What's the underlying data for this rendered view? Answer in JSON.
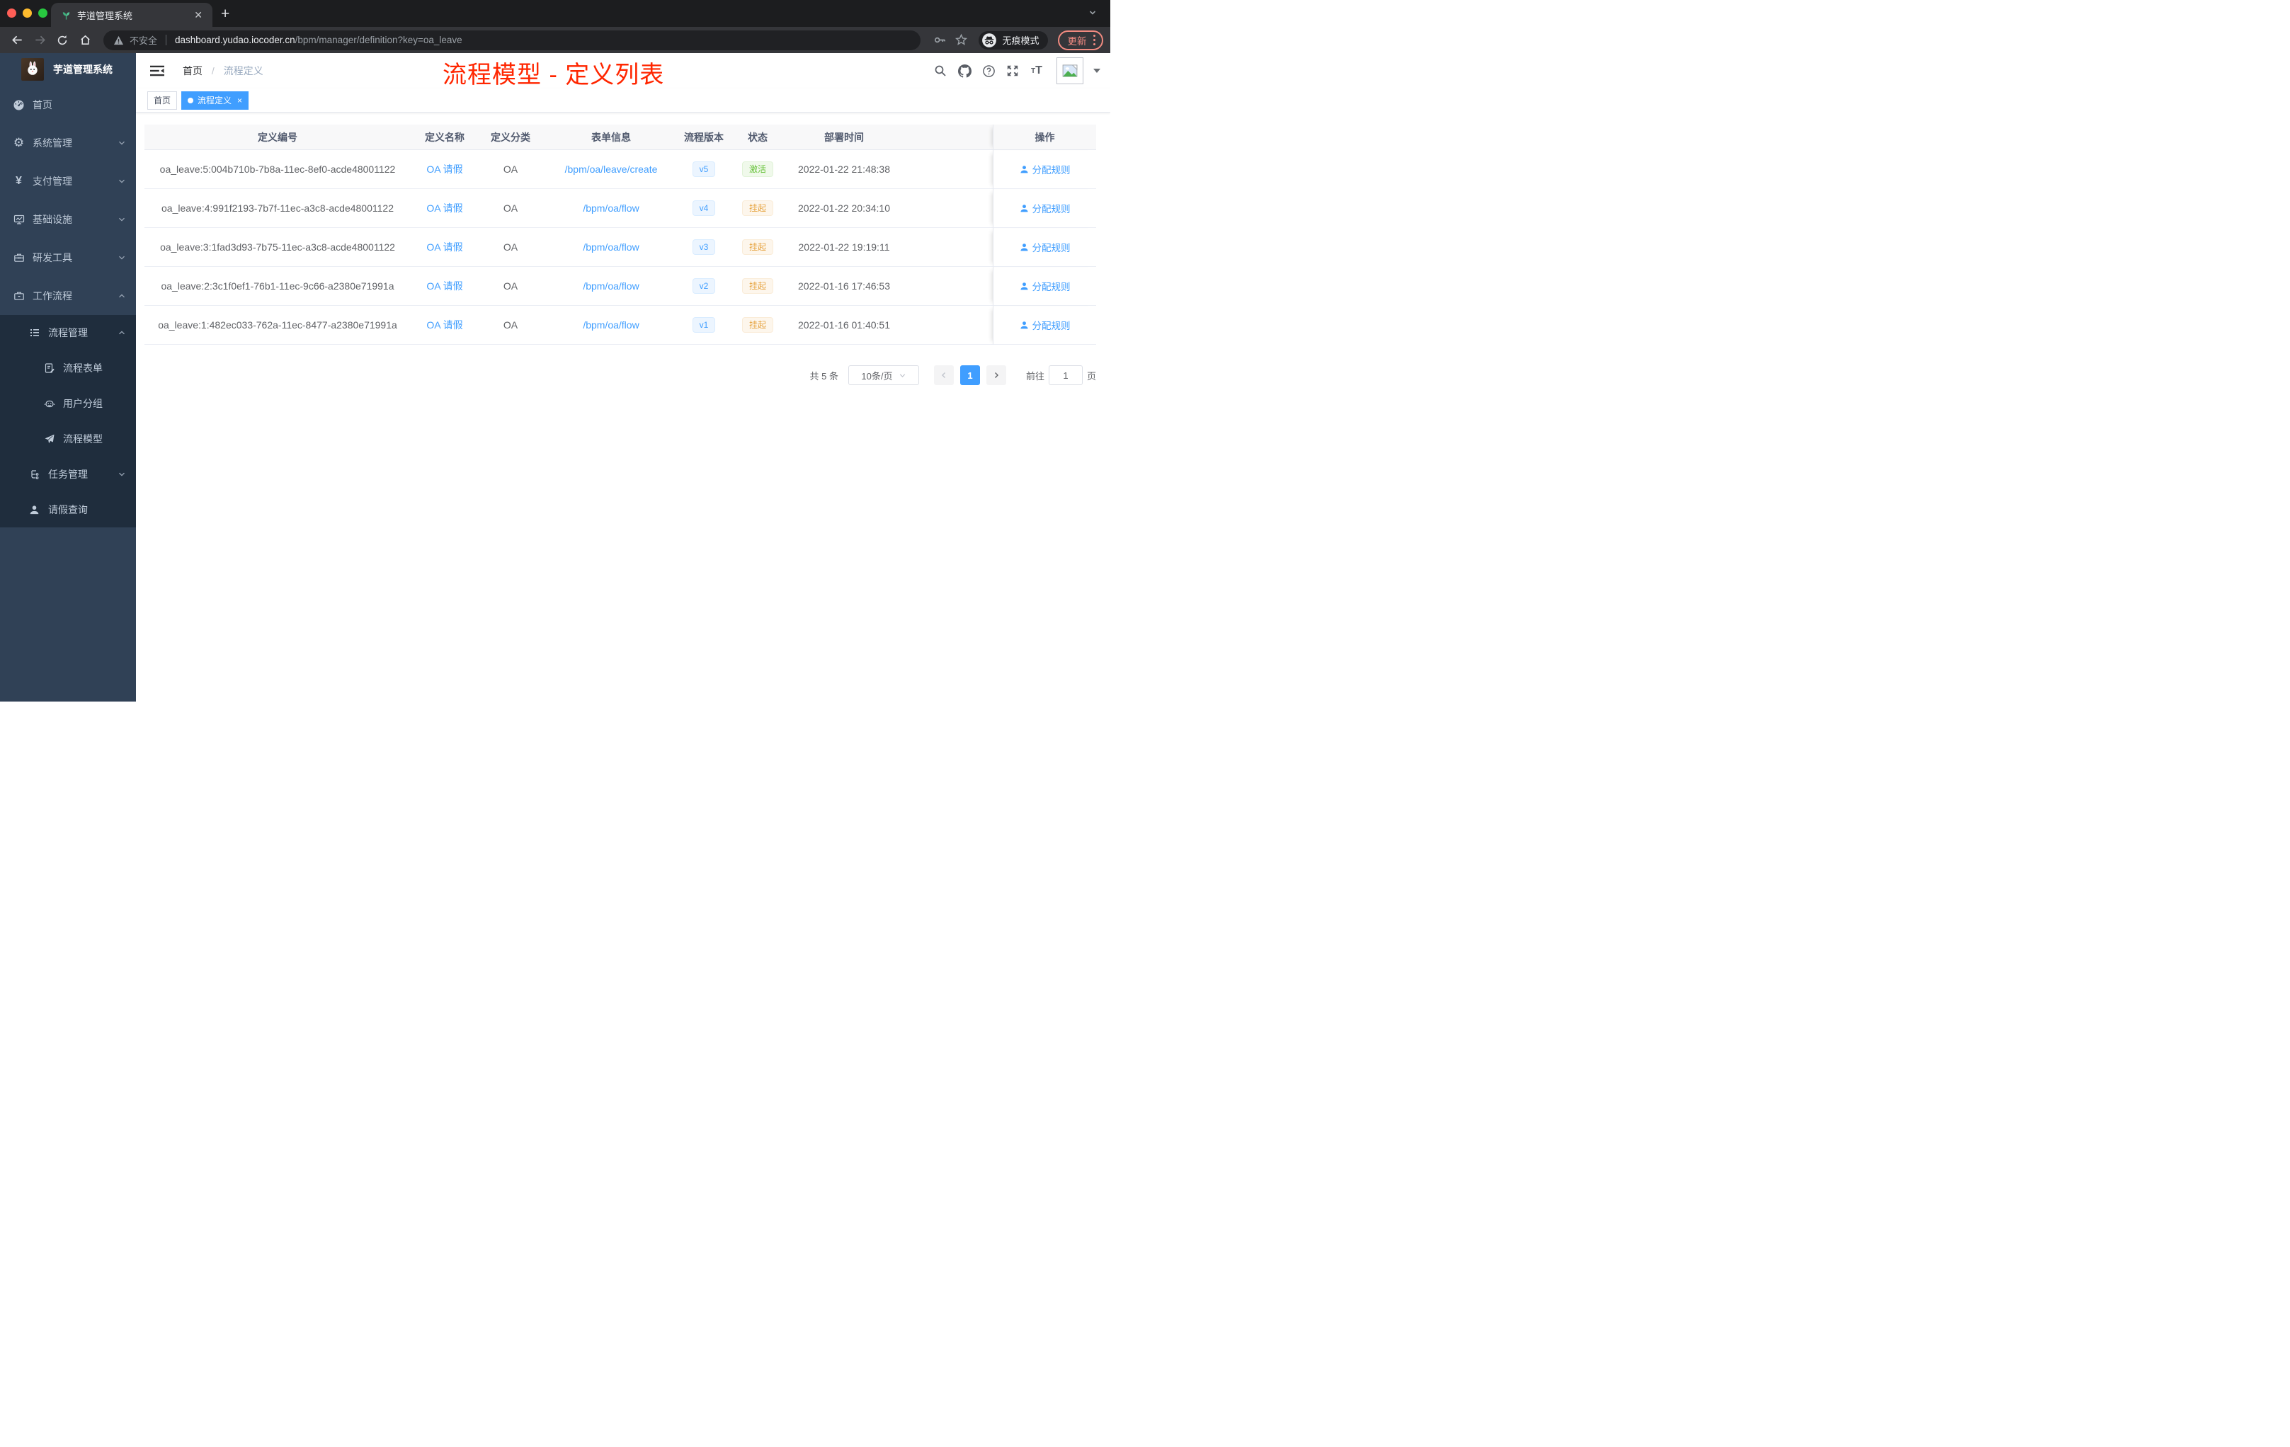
{
  "browser": {
    "tab_title": "芋道管理系统",
    "new_tab": "+",
    "security_label": "不安全",
    "url_domain": "dashboard.yudao.iocoder.cn",
    "url_path": "/bpm/manager/definition?key=oa_leave",
    "incognito_label": "无痕模式",
    "update_label": "更新"
  },
  "annotation": "流程模型 - 定义列表",
  "sidebar": {
    "title": "芋道管理系统",
    "items": [
      {
        "label": "首页"
      },
      {
        "label": "系统管理"
      },
      {
        "label": "支付管理"
      },
      {
        "label": "基础设施"
      },
      {
        "label": "研发工具"
      },
      {
        "label": "工作流程"
      },
      {
        "label": "流程管理"
      },
      {
        "label": "流程表单"
      },
      {
        "label": "用户分组"
      },
      {
        "label": "流程模型"
      },
      {
        "label": "任务管理"
      },
      {
        "label": "请假查询"
      }
    ]
  },
  "navbar": {
    "breadcrumb_home": "首页",
    "breadcrumb_sep": "/",
    "breadcrumb_current": "流程定义"
  },
  "tags": {
    "home": "首页",
    "active": "流程定义",
    "close": "×"
  },
  "table": {
    "columns": [
      "定义编号",
      "定义名称",
      "定义分类",
      "表单信息",
      "流程版本",
      "状态",
      "部署时间",
      "操作"
    ],
    "rows": [
      {
        "id": "oa_leave:5:004b710b-7b8a-11ec-8ef0-acde48001122",
        "name": "OA 请假",
        "category": "OA",
        "form": "/bpm/oa/leave/create",
        "version": "v5",
        "status": "激活",
        "status_type": "success",
        "time": "2022-01-22 21:48:38",
        "action": "分配规则"
      },
      {
        "id": "oa_leave:4:991f2193-7b7f-11ec-a3c8-acde48001122",
        "name": "OA 请假",
        "category": "OA",
        "form": "/bpm/oa/flow",
        "version": "v4",
        "status": "挂起",
        "status_type": "warning",
        "time": "2022-01-22 20:34:10",
        "action": "分配规则"
      },
      {
        "id": "oa_leave:3:1fad3d93-7b75-11ec-a3c8-acde48001122",
        "name": "OA 请假",
        "category": "OA",
        "form": "/bpm/oa/flow",
        "version": "v3",
        "status": "挂起",
        "status_type": "warning",
        "time": "2022-01-22 19:19:11",
        "action": "分配规则"
      },
      {
        "id": "oa_leave:2:3c1f0ef1-76b1-11ec-9c66-a2380e71991a",
        "name": "OA 请假",
        "category": "OA",
        "form": "/bpm/oa/flow",
        "version": "v2",
        "status": "挂起",
        "status_type": "warning",
        "time": "2022-01-16 17:46:53",
        "action": "分配规则"
      },
      {
        "id": "oa_leave:1:482ec033-762a-11ec-8477-a2380e71991a",
        "name": "OA 请假",
        "category": "OA",
        "form": "/bpm/oa/flow",
        "version": "v1",
        "status": "挂起",
        "status_type": "warning",
        "time": "2022-01-16 01:40:51",
        "action": "分配规则"
      }
    ]
  },
  "pagination": {
    "total": "共 5 条",
    "page_size": "10条/页",
    "current_page": "1",
    "goto_label": "前往",
    "goto_value": "1",
    "page_unit": "页"
  },
  "colors": {
    "accent": "#409EFF",
    "success": "#67C23A",
    "warning": "#E6A23C",
    "annotation_red": "#FF2600",
    "sidebar_bg": "#304156",
    "submenu_bg": "#1F2D3D"
  }
}
